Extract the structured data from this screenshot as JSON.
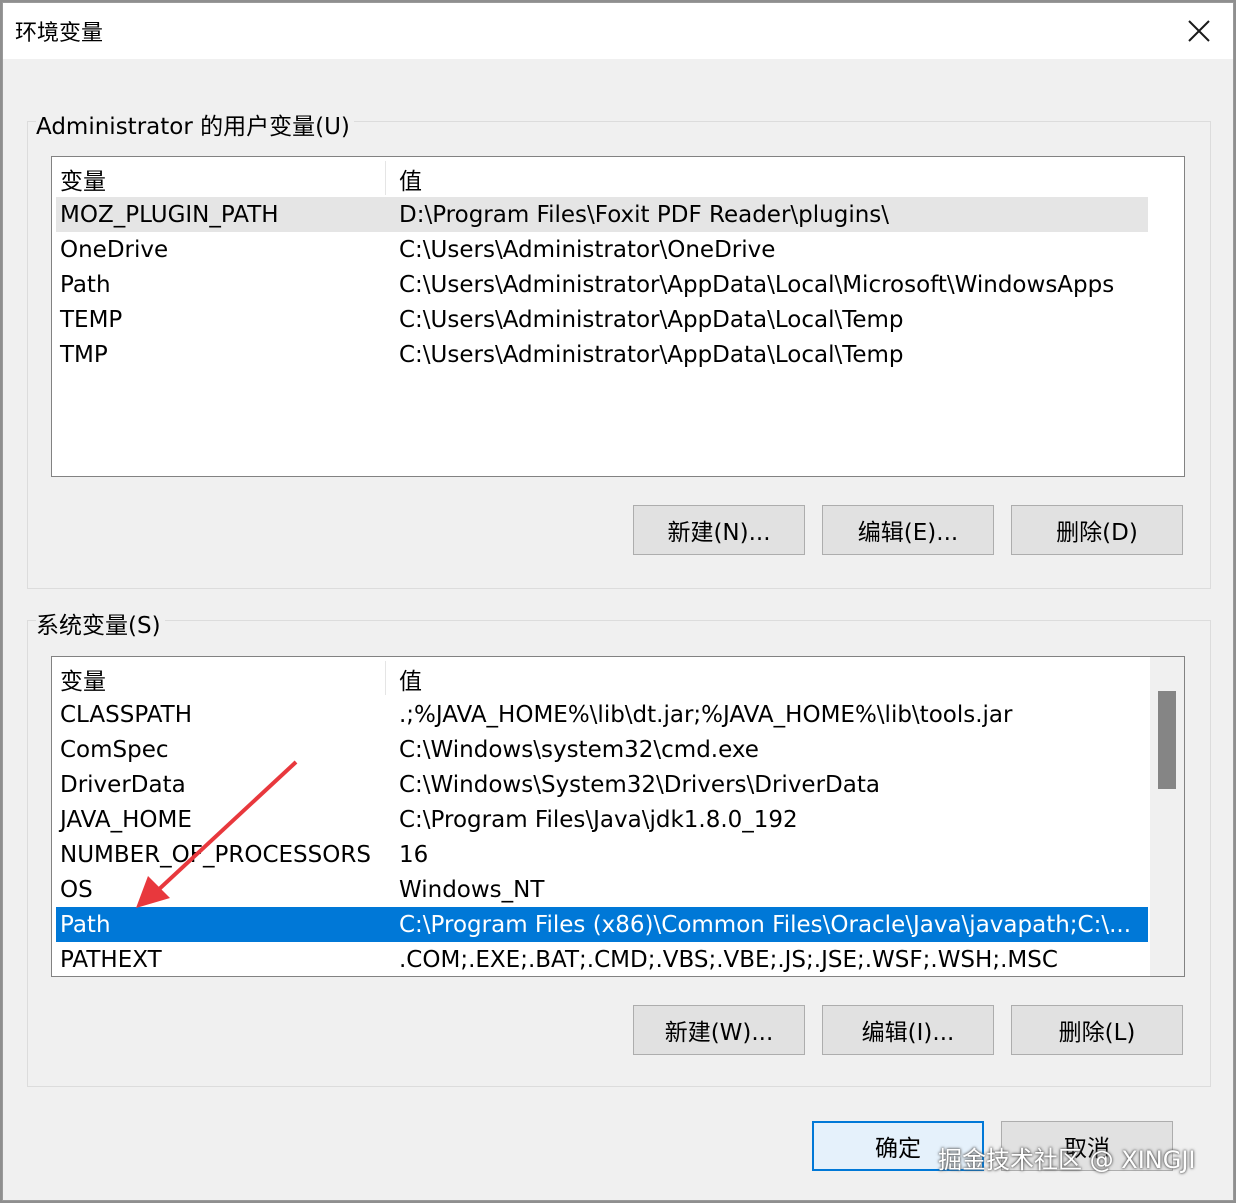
{
  "window": {
    "title": "环境变量"
  },
  "user_vars": {
    "group_label": "Administrator 的用户变量(U)",
    "headers": {
      "name": "变量",
      "value": "值"
    },
    "rows": [
      {
        "name": "MOZ_PLUGIN_PATH",
        "value": "D:\\Program Files\\Foxit PDF Reader\\plugins\\"
      },
      {
        "name": "OneDrive",
        "value": "C:\\Users\\Administrator\\OneDrive"
      },
      {
        "name": "Path",
        "value": "C:\\Users\\Administrator\\AppData\\Local\\Microsoft\\WindowsApps"
      },
      {
        "name": "TEMP",
        "value": "C:\\Users\\Administrator\\AppData\\Local\\Temp"
      },
      {
        "name": "TMP",
        "value": "C:\\Users\\Administrator\\AppData\\Local\\Temp"
      }
    ],
    "buttons": {
      "new": "新建(N)...",
      "edit": "编辑(E)...",
      "delete": "删除(D)"
    }
  },
  "system_vars": {
    "group_label": "系统变量(S)",
    "headers": {
      "name": "变量",
      "value": "值"
    },
    "rows": [
      {
        "name": "CLASSPATH",
        "value": ".;%JAVA_HOME%\\lib\\dt.jar;%JAVA_HOME%\\lib\\tools.jar"
      },
      {
        "name": "ComSpec",
        "value": "C:\\Windows\\system32\\cmd.exe"
      },
      {
        "name": "DriverData",
        "value": "C:\\Windows\\System32\\Drivers\\DriverData"
      },
      {
        "name": "JAVA_HOME",
        "value": "C:\\Program Files\\Java\\jdk1.8.0_192"
      },
      {
        "name": "NUMBER_OF_PROCESSORS",
        "value": "16"
      },
      {
        "name": "OS",
        "value": "Windows_NT"
      },
      {
        "name": "Path",
        "value": "C:\\Program Files (x86)\\Common Files\\Oracle\\Java\\javapath;C:\\..."
      },
      {
        "name": "PATHEXT",
        "value": ".COM;.EXE;.BAT;.CMD;.VBS;.VBE;.JS;.JSE;.WSF;.WSH;.MSC"
      }
    ],
    "selected_row": "Path",
    "buttons": {
      "new": "新建(W)...",
      "edit": "编辑(I)...",
      "delete": "删除(L)"
    }
  },
  "footer": {
    "ok": "确定",
    "cancel": "取消"
  },
  "watermark": "掘金技术社区 @ XINGJI",
  "colors": {
    "selection": "#0078d7",
    "annotation_arrow": "#e8383d"
  }
}
